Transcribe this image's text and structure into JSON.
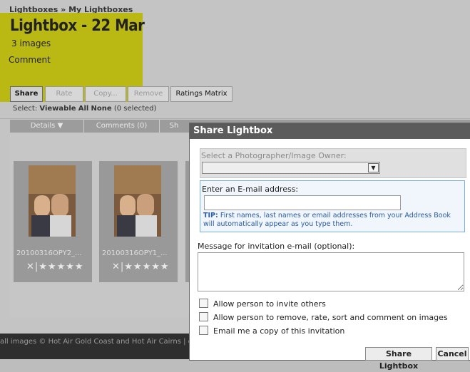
{
  "breadcrumb": {
    "link": "Lightboxes",
    "separator": "»",
    "current": "My Lightboxes"
  },
  "lightbox": {
    "title": "Lightbox - 22 Mar",
    "count": "3 images",
    "comment": "Comment"
  },
  "toolbar": {
    "share": "Share",
    "rate": "Rate",
    "copy": "Copy...",
    "remove": "Remove",
    "ratings_matrix": "Ratings Matrix"
  },
  "select_bar": {
    "label": "Select:",
    "viewable": "Viewable",
    "all": "All",
    "none": "None",
    "selected": "(0 selected)"
  },
  "tabs": {
    "details": "Details ▼",
    "comments": "Comments (0)",
    "share": "Sh"
  },
  "thumbs": [
    {
      "filename": "20100316OPY2_...",
      "rating": "✕|★★★★★"
    },
    {
      "filename": "20100316OPY1_...",
      "rating": "✕|★★★★★"
    }
  ],
  "footer": {
    "text": "all images © Hot Air Gold Coast and Hot Air Cairns  |  conta"
  },
  "dialog": {
    "title": "Share Lightbox",
    "owner_label": "Select a Photographer/Image Owner:",
    "owner_value": "",
    "email_label": "Enter an E-mail address:",
    "email_value": "",
    "tip_label": "TIP:",
    "tip_text": "First names, last names or email addresses from your Address Book will automatically appear as you type them.",
    "message_label": "Message for invitation e-mail (optional):",
    "message_value": "",
    "options": [
      {
        "label": "Allow person to invite others",
        "checked": false
      },
      {
        "label": "Allow person to remove, rate, sort and comment on images",
        "checked": false
      },
      {
        "label": "Email me a copy of this invitation",
        "checked": false
      }
    ],
    "share_button": "Share Lightbox",
    "cancel_button": "Cancel"
  },
  "colors": {
    "dialog_header": "#5b5b5b",
    "highlight": "#b9b800",
    "tip_text": "#2a5ca8",
    "email_border": "#7aaedc"
  },
  "icons": {
    "dropdown": "chevron-down-icon",
    "star": "star-icon",
    "reject": "close-icon"
  }
}
